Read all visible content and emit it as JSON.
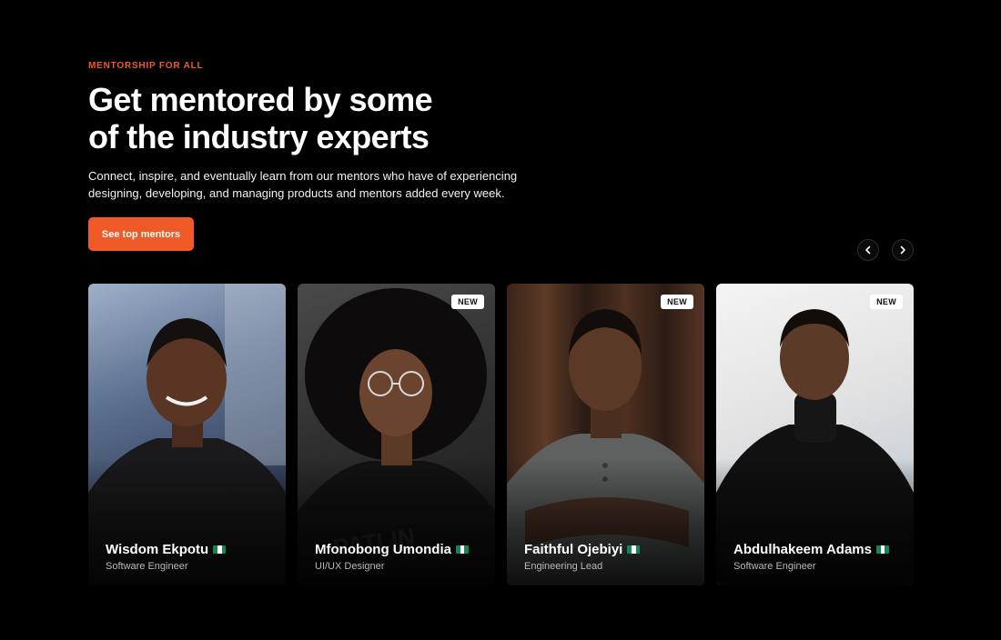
{
  "hero": {
    "eyebrow": "MENTORSHIP FOR ALL",
    "headline_line1": "Get mentored by some",
    "headline_line2": "of the industry experts",
    "description": "Connect, inspire, and eventually learn from our  mentors who have of experiencing designing, developing, and managing products and mentors added every week.",
    "cta_label": "See top mentors"
  },
  "carousel": {
    "prev_icon": "chevron-left-icon",
    "next_icon": "chevron-right-icon",
    "mentors": [
      {
        "name": "Wisdom Ekpotu",
        "role": "Software Engineer",
        "badge": "",
        "flag": "nigeria-flag-icon"
      },
      {
        "name": "Mfonobong Umondia",
        "role": "UI/UX Designer",
        "badge": "NEW",
        "flag": "nigeria-flag-icon"
      },
      {
        "name": "Faithful Ojebiyi",
        "role": "Engineering Lead",
        "badge": "NEW",
        "flag": "nigeria-flag-icon"
      },
      {
        "name": "Abdulhakeem Adams",
        "role": "Software Engineer",
        "badge": "NEW",
        "flag": "nigeria-flag-icon"
      }
    ]
  },
  "colors": {
    "background": "#000000",
    "accent": "#f05a28",
    "text": "#ffffff"
  }
}
